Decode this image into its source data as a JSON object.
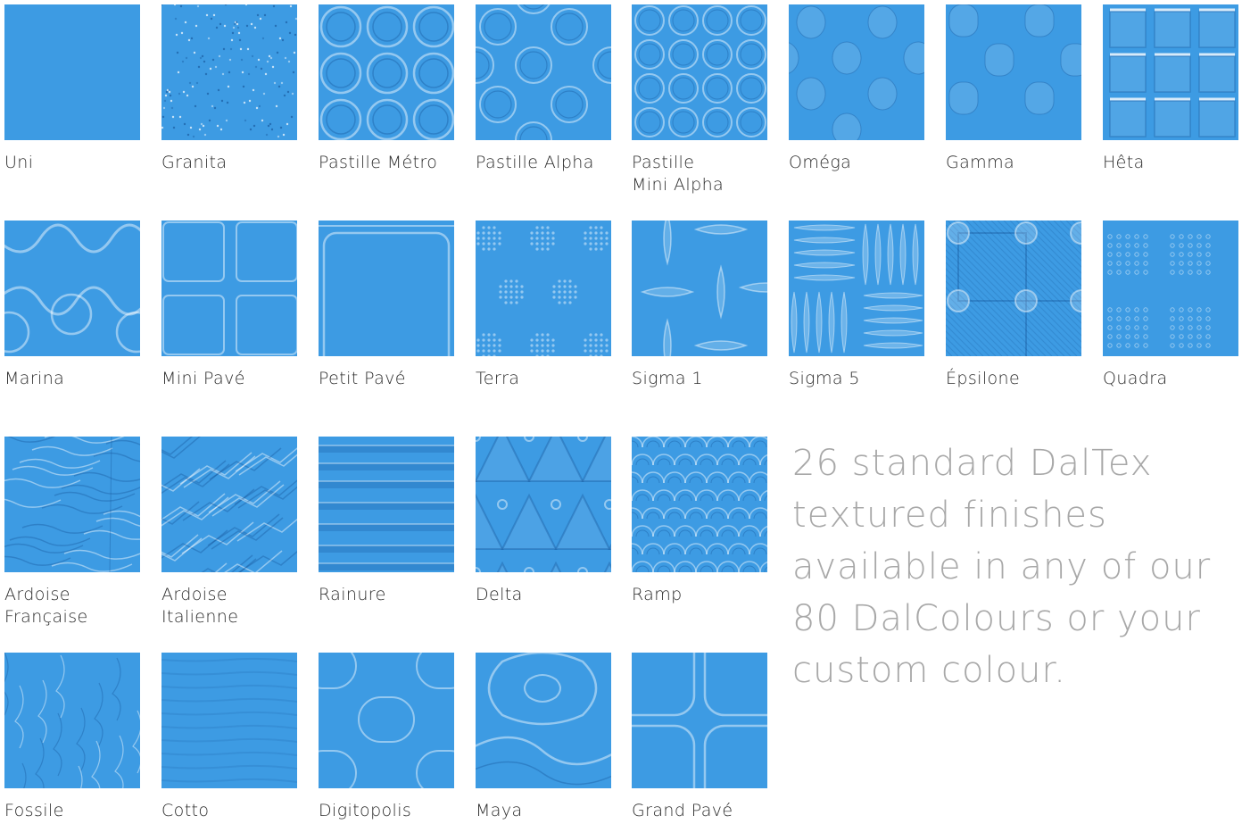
{
  "swatch_color": "#3d9be3",
  "headline_lines": [
    "26 standard DalTex",
    "textured finishes",
    "available in any of our",
    "80 DalColours or your",
    "custom colour."
  ],
  "finishes": [
    {
      "label": "Uni",
      "pattern": "plain"
    },
    {
      "label": "Granita",
      "pattern": "speckle"
    },
    {
      "label": "Pastille Métro",
      "pattern": "circles-large"
    },
    {
      "label": "Pastille Alpha",
      "pattern": "circles-offset"
    },
    {
      "label": "Pastille\nMini Alpha",
      "pattern": "circles-small"
    },
    {
      "label": "Oméga",
      "pattern": "dots-soft"
    },
    {
      "label": "Gamma",
      "pattern": "rounded-squares-soft"
    },
    {
      "label": "Hêta",
      "pattern": "grid-squares"
    },
    {
      "label": "Marina",
      "pattern": "waves"
    },
    {
      "label": "Mini Pavé",
      "pattern": "pave-small"
    },
    {
      "label": "Petit Pavé",
      "pattern": "pave-large"
    },
    {
      "label": "Terra",
      "pattern": "dot-clusters"
    },
    {
      "label": "Sigma 1",
      "pattern": "lens-single"
    },
    {
      "label": "Sigma 5",
      "pattern": "lens-multi"
    },
    {
      "label": "Épsilone",
      "pattern": "hatched-squares"
    },
    {
      "label": "Quadra",
      "pattern": "dot-grid"
    },
    {
      "label": "Ardoise\nFrançaise",
      "pattern": "slate"
    },
    {
      "label": "Ardoise\nItalienne",
      "pattern": "slate-rough"
    },
    {
      "label": "Rainure",
      "pattern": "stripes"
    },
    {
      "label": "Delta",
      "pattern": "triangles"
    },
    {
      "label": "Ramp",
      "pattern": "scales"
    },
    {
      "label": "Fossile",
      "pattern": "fossil"
    },
    {
      "label": "Cotto",
      "pattern": "cotto"
    },
    {
      "label": "Digitopolis",
      "pattern": "digits"
    },
    {
      "label": "Maya",
      "pattern": "maya"
    },
    {
      "label": "Grand Pavé",
      "pattern": "grand-pave"
    }
  ]
}
